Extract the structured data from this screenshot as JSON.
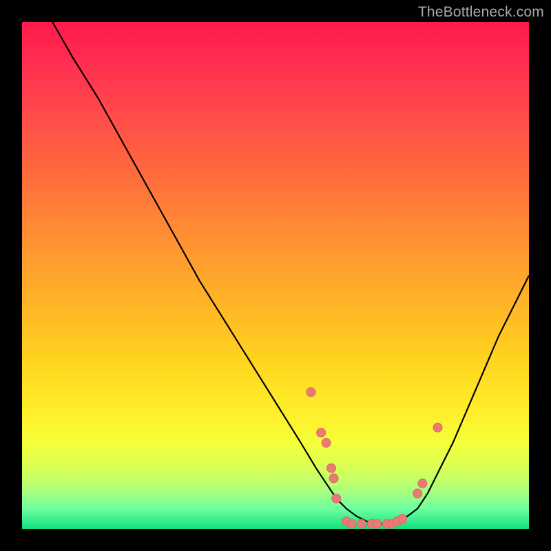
{
  "watermark": "TheBottleneck.com",
  "chart_data": {
    "type": "line",
    "title": "",
    "xlabel": "",
    "ylabel": "",
    "xlim": [
      0,
      100
    ],
    "ylim": [
      0,
      100
    ],
    "grid": false,
    "series": [
      {
        "name": "curve",
        "x": [
          6,
          10,
          15,
          20,
          25,
          30,
          35,
          40,
          45,
          50,
          55,
          58,
          60,
          62,
          64,
          66,
          68,
          70,
          72,
          74,
          76,
          78,
          80,
          82,
          85,
          88,
          91,
          94,
          97,
          100
        ],
        "values": [
          100,
          93,
          85,
          76,
          67,
          58,
          49,
          41,
          33,
          25,
          17,
          12,
          9,
          6,
          4,
          2.5,
          1.5,
          1,
          1,
          1.5,
          2.5,
          4,
          7,
          11,
          17,
          24,
          31,
          38,
          44,
          50
        ]
      }
    ],
    "points": [
      {
        "x": 57,
        "y": 27
      },
      {
        "x": 59,
        "y": 19
      },
      {
        "x": 60,
        "y": 17
      },
      {
        "x": 61,
        "y": 12
      },
      {
        "x": 61.5,
        "y": 10
      },
      {
        "x": 62,
        "y": 6
      },
      {
        "x": 64,
        "y": 1.5
      },
      {
        "x": 65,
        "y": 1
      },
      {
        "x": 67,
        "y": 1
      },
      {
        "x": 69,
        "y": 1
      },
      {
        "x": 70,
        "y": 1
      },
      {
        "x": 72,
        "y": 1
      },
      {
        "x": 73,
        "y": 1
      },
      {
        "x": 74,
        "y": 1.5
      },
      {
        "x": 75,
        "y": 2
      },
      {
        "x": 78,
        "y": 7
      },
      {
        "x": 79,
        "y": 9
      },
      {
        "x": 82,
        "y": 20
      }
    ],
    "gradient_stops": [
      {
        "pos": 0,
        "color": "#ff1a4d"
      },
      {
        "pos": 50,
        "color": "#ffc020"
      },
      {
        "pos": 85,
        "color": "#eaff40"
      },
      {
        "pos": 100,
        "color": "#12e07e"
      }
    ]
  }
}
